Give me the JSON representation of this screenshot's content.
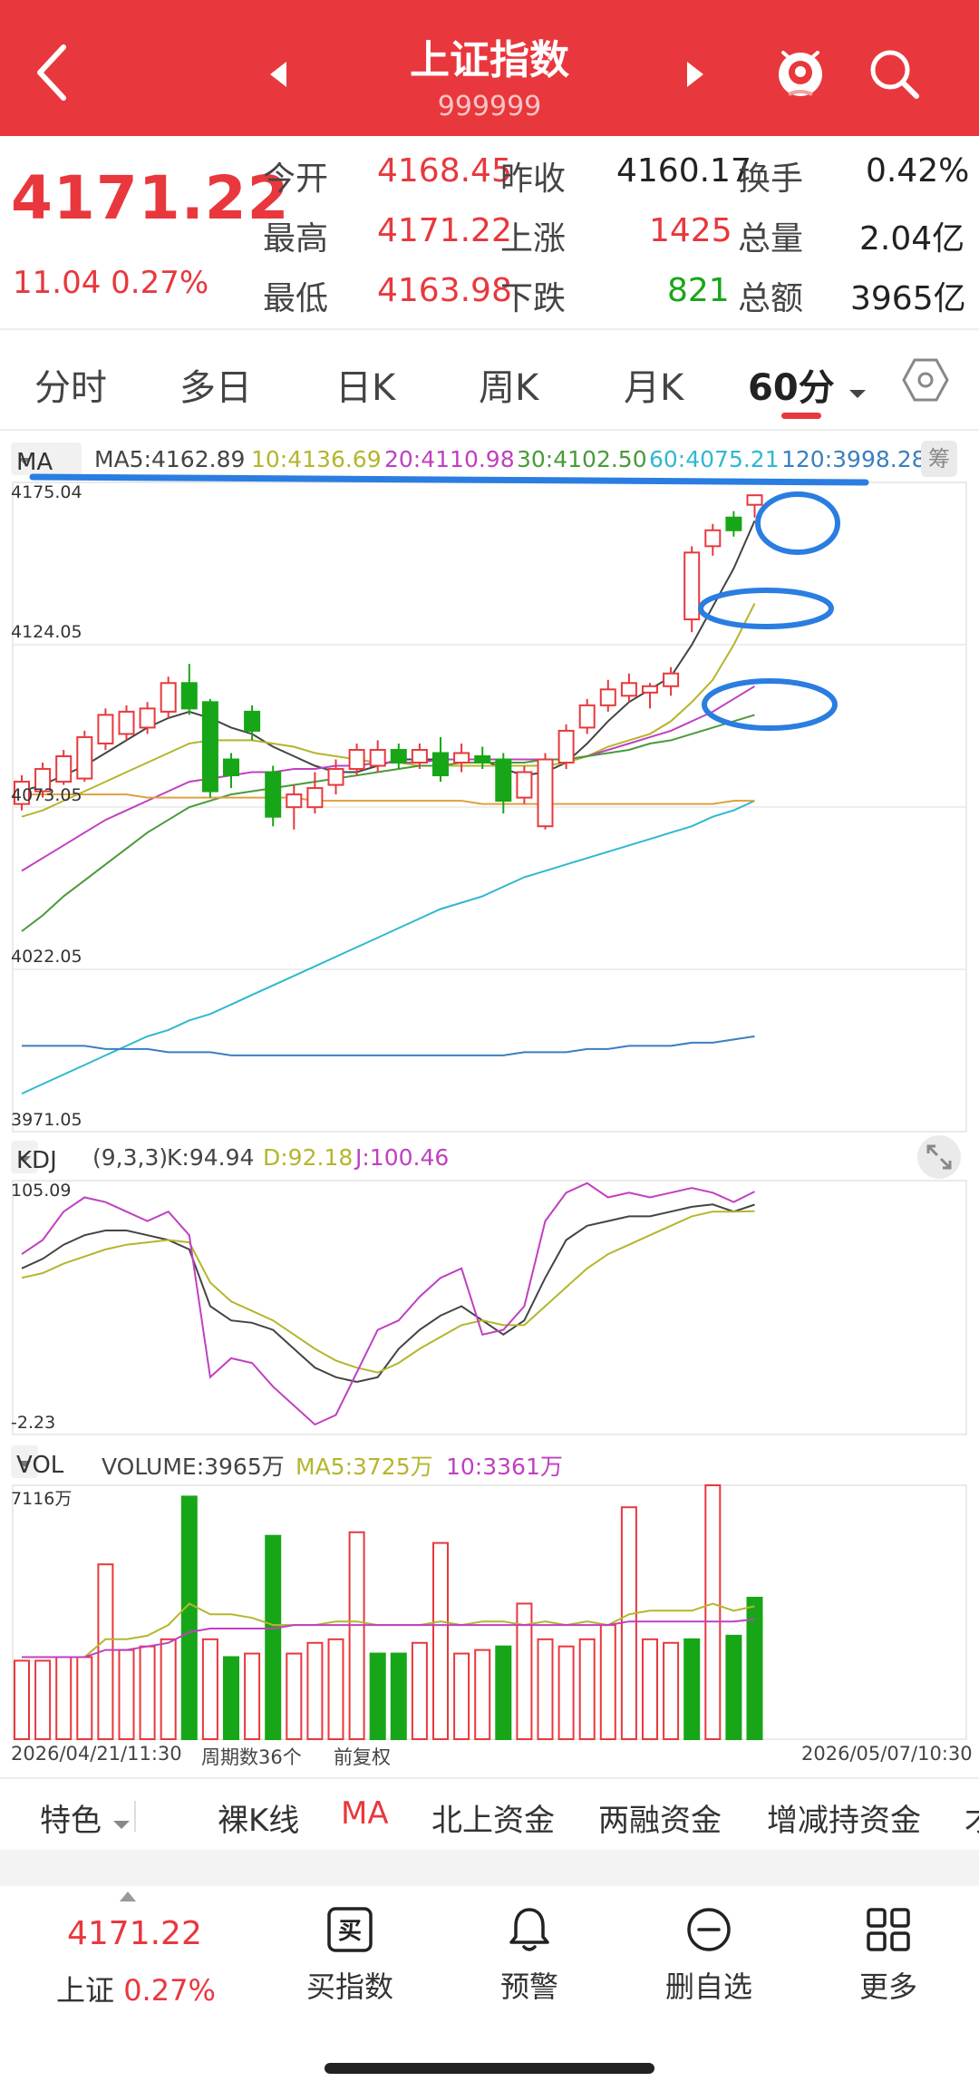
{
  "header": {
    "title": "上证指数",
    "code": "999999",
    "bg_color": "#e8383d"
  },
  "quote": {
    "price": "4171.22",
    "change": "11.04",
    "change_pct": "0.27%",
    "rows": [
      {
        "l1": "今开",
        "v1": "4168.45",
        "l2": "昨收",
        "v2": "4160.17",
        "l3": "换手",
        "v3": "0.42%"
      },
      {
        "l1": "最高",
        "v1": "4171.22",
        "l2": "上涨",
        "v2": "1425",
        "l3": "总量",
        "v3": "2.04亿"
      },
      {
        "l1": "最低",
        "v1": "4163.98",
        "l2": "下跌",
        "v2": "821",
        "l3": "总额",
        "v3": "3965亿"
      }
    ]
  },
  "tabs": {
    "items": [
      "分时",
      "多日",
      "日K",
      "周K",
      "月K",
      "60分"
    ],
    "active": "60分"
  },
  "ma_legend": {
    "selector": "MA",
    "ma5": "MA5:4162.89",
    "ma10": "10:4136.69",
    "ma20": "20:4110.98",
    "ma30": "30:4102.50",
    "ma60": "60:4075.21",
    "ma120": "120:3998.28",
    "chou": "筹"
  },
  "axis": {
    "y1": "4175.04",
    "y2": "4124.05",
    "y3": "4073.05",
    "y4": "4022.05",
    "y5": "3971.05"
  },
  "kdj": {
    "selector": "KDJ",
    "params": "(9,3,3)",
    "k": "K:94.94",
    "d": "D:92.18",
    "j": "J:100.46",
    "top": "105.09",
    "bottom": "-2.23"
  },
  "vol": {
    "selector": "VOL",
    "volume": "VOLUME:3965万",
    "ma5": "MA5:3725万",
    "ma10": "10:3361万",
    "top": "7116万"
  },
  "dates": {
    "start": "2026/04/21/11:30",
    "periods": "周期数36个",
    "adjust": "前复权",
    "end": "2026/05/07/10:30"
  },
  "indicator_tabs": {
    "first": "特色",
    "items": [
      "裸K线",
      "MA",
      "北上资金",
      "两融资金",
      "增减持资金",
      "才"
    ],
    "active": "MA"
  },
  "bottom": {
    "price": "4171.22",
    "name": "上证",
    "pct": "0.27%",
    "buy_icon_char": "买",
    "buy": "买指数",
    "alert": "预警",
    "remove": "删自选",
    "more": "更多"
  },
  "colors": {
    "up": "#e8383d",
    "down": "#17a617",
    "ma5": "#444444",
    "ma10": "#b5b52e",
    "ma20": "#c040c0",
    "ma30": "#4a9a3a",
    "ma60": "#2fb8d0",
    "ma120": "#3a7fc0",
    "annotation": "#2a7de1"
  },
  "chart_data": [
    {
      "type": "candlestick",
      "title": "上证指数 60分",
      "ylim": [
        3971.05,
        4175.04
      ],
      "y_ticks": [
        4175.04,
        4124.05,
        4073.05,
        4022.05,
        3971.05
      ],
      "x_start": "2026/04/21/11:30",
      "x_end": "2026/05/07/10:30",
      "candles": [
        [
          4074,
          4081,
          4072,
          4083
        ],
        [
          4078,
          4085,
          4076,
          4087
        ],
        [
          4081,
          4089,
          4080,
          4091
        ],
        [
          4082,
          4095,
          4081,
          4097
        ],
        [
          4093,
          4102,
          4091,
          4104
        ],
        [
          4096,
          4103,
          4094,
          4105
        ],
        [
          4098,
          4104,
          4096,
          4106
        ],
        [
          4103,
          4112,
          4101,
          4114
        ],
        [
          4112,
          4104,
          4102,
          4118
        ],
        [
          4106,
          4078,
          4076,
          4107
        ],
        [
          4088,
          4083,
          4079,
          4090
        ],
        [
          4103,
          4097,
          4094,
          4105
        ],
        [
          4084,
          4070,
          4067,
          4086
        ],
        [
          4073,
          4077,
          4066,
          4080
        ],
        [
          4073,
          4079,
          4071,
          4084
        ],
        [
          4080,
          4085,
          4077,
          4088
        ],
        [
          4085,
          4091,
          4083,
          4093
        ],
        [
          4086,
          4091,
          4084,
          4094
        ],
        [
          4091,
          4087,
          4085,
          4093
        ],
        [
          4087,
          4091,
          4085,
          4093
        ],
        [
          4090,
          4083,
          4081,
          4095
        ],
        [
          4087,
          4090,
          4084,
          4093
        ],
        [
          4089,
          4087,
          4085,
          4092
        ],
        [
          4088,
          4075,
          4071,
          4090
        ],
        [
          4076,
          4084,
          4074,
          4086
        ],
        [
          4067,
          4088,
          4066,
          4090
        ],
        [
          4087,
          4097,
          4085,
          4099
        ],
        [
          4098,
          4105,
          4096,
          4107
        ],
        [
          4105,
          4110,
          4103,
          4113
        ],
        [
          4108,
          4112,
          4106,
          4115
        ],
        [
          4109,
          4111,
          4104,
          4112
        ],
        [
          4111,
          4115,
          4108,
          4117
        ],
        [
          4132,
          4153,
          4128,
          4155
        ],
        [
          4155,
          4160,
          4152,
          4162
        ],
        [
          4164,
          4160,
          4158,
          4166
        ],
        [
          4168,
          4171,
          4164,
          4171
        ]
      ],
      "ma_series": {
        "MA5": [
          4078,
          4080,
          4083,
          4086,
          4090,
          4094,
          4098,
          4101,
          4103,
          4101,
          4098,
          4096,
          4092,
          4089,
          4086,
          4084,
          4084,
          4086,
          4088,
          4088,
          4088,
          4088,
          4088,
          4085,
          4083,
          4084,
          4087,
          4093,
          4100,
          4106,
          4110,
          4114,
          4124,
          4136,
          4148,
          4163
        ],
        "MA10": [
          4070,
          4072,
          4075,
          4078,
          4081,
          4084,
          4087,
          4090,
          4093,
          4094,
          4094,
          4094,
          4093,
          4092,
          4090,
          4089,
          4088,
          4087,
          4087,
          4086,
          4086,
          4086,
          4086,
          4086,
          4086,
          4086,
          4087,
          4089,
          4092,
          4094,
          4096,
          4100,
          4106,
          4113,
          4124,
          4137
        ],
        "MA20": [
          4053,
          4057,
          4061,
          4065,
          4069,
          4072,
          4075,
          4078,
          4081,
          4082,
          4083,
          4084,
          4084,
          4085,
          4085,
          4086,
          4086,
          4087,
          4087,
          4087,
          4088,
          4088,
          4088,
          4088,
          4088,
          4088,
          4088,
          4089,
          4091,
          4093,
          4095,
          4097,
          4100,
          4103,
          4107,
          4111
        ],
        "MA30": [
          4034,
          4039,
          4045,
          4050,
          4055,
          4060,
          4065,
          4069,
          4073,
          4075,
          4077,
          4078,
          4079,
          4080,
          4081,
          4082,
          4083,
          4084,
          4085,
          4086,
          4086,
          4087,
          4087,
          4087,
          4087,
          4088,
          4088,
          4089,
          4090,
          4091,
          4093,
          4094,
          4096,
          4098,
          4100,
          4102
        ],
        "MA60": [
          3983,
          3986,
          3989,
          3992,
          3995,
          3998,
          4001,
          4003,
          4006,
          4008,
          4011,
          4014,
          4017,
          4020,
          4023,
          4026,
          4029,
          4032,
          4035,
          4038,
          4041,
          4043,
          4045,
          4048,
          4051,
          4053,
          4055,
          4057,
          4059,
          4061,
          4063,
          4065,
          4067,
          4070,
          4072,
          4075
        ],
        "MA120": [
          3998,
          3998,
          3998,
          3998,
          3997,
          3997,
          3997,
          3996,
          3996,
          3996,
          3995,
          3995,
          3995,
          3995,
          3995,
          3995,
          3995,
          3995,
          3995,
          3995,
          3995,
          3995,
          3995,
          3995,
          3996,
          3996,
          3996,
          3997,
          3997,
          3998,
          3998,
          3998,
          3999,
          3999,
          4000,
          4001
        ],
        "MA_orange": [
          4077,
          4077,
          4077,
          4077,
          4077,
          4077,
          4076,
          4076,
          4076,
          4076,
          4076,
          4076,
          4076,
          4076,
          4075,
          4075,
          4075,
          4075,
          4075,
          4075,
          4075,
          4075,
          4074,
          4074,
          4074,
          4074,
          4074,
          4074,
          4074,
          4074,
          4074,
          4074,
          4074,
          4074,
          4075,
          4075
        ]
      }
    },
    {
      "type": "line",
      "title": "KDJ (9,3,3)",
      "ylim": [
        -2.23,
        105.09
      ],
      "series": [
        {
          "name": "K",
          "values": [
            68,
            72,
            78,
            82,
            84,
            84,
            82,
            80,
            76,
            52,
            46,
            45,
            42,
            34,
            26,
            22,
            20,
            22,
            34,
            42,
            48,
            52,
            46,
            40,
            46,
            64,
            80,
            86,
            88,
            90,
            90,
            92,
            94,
            95,
            92,
            94.94
          ]
        },
        {
          "name": "D",
          "values": [
            64,
            66,
            70,
            73,
            76,
            78,
            79,
            80,
            79,
            62,
            54,
            50,
            46,
            40,
            34,
            29,
            26,
            24,
            28,
            34,
            39,
            44,
            46,
            44,
            44,
            52,
            60,
            68,
            74,
            78,
            82,
            86,
            90,
            92,
            92,
            92.18
          ]
        },
        {
          "name": "J",
          "values": [
            74,
            80,
            92,
            98,
            96,
            92,
            88,
            92,
            82,
            22,
            30,
            28,
            18,
            10,
            2,
            6,
            24,
            42,
            46,
            56,
            64,
            68,
            40,
            42,
            52,
            88,
            100,
            104,
            98,
            100,
            98,
            100,
            102,
            100,
            96,
            100.46
          ]
        }
      ]
    },
    {
      "type": "bar",
      "title": "VOLUME",
      "ylim": [
        0,
        7116
      ],
      "unit": "万",
      "values": [
        2200,
        2200,
        2300,
        2300,
        4900,
        2500,
        2600,
        2800,
        6800,
        2800,
        2300,
        2400,
        5700,
        2400,
        2700,
        2800,
        5800,
        2400,
        2400,
        2700,
        5500,
        2400,
        2500,
        2600,
        3800,
        2800,
        2600,
        2800,
        3200,
        6500,
        2800,
        2700,
        2800,
        7116,
        2900,
        3965
      ],
      "direction": [
        "up",
        "up",
        "up",
        "up",
        "up",
        "up",
        "up",
        "up",
        "down",
        "up",
        "down",
        "up",
        "down",
        "up",
        "up",
        "up",
        "up",
        "down",
        "down",
        "up",
        "up",
        "up",
        "up",
        "down",
        "up",
        "up",
        "up",
        "up",
        "up",
        "up",
        "up",
        "up",
        "down",
        "up",
        "down",
        "down"
      ],
      "series": [
        {
          "name": "MA5",
          "values": [
            2300,
            2300,
            2300,
            2300,
            2800,
            2800,
            2900,
            3200,
            3800,
            3500,
            3500,
            3400,
            3200,
            3200,
            3200,
            3300,
            3300,
            3200,
            3200,
            3200,
            3300,
            3200,
            3300,
            3300,
            3200,
            3300,
            3200,
            3300,
            3200,
            3500,
            3600,
            3600,
            3600,
            3800,
            3600,
            3725
          ]
        },
        {
          "name": "10",
          "values": [
            2300,
            2300,
            2300,
            2300,
            2500,
            2500,
            2600,
            2700,
            3000,
            3100,
            3100,
            3100,
            3100,
            3200,
            3200,
            3200,
            3200,
            3200,
            3200,
            3200,
            3200,
            3200,
            3200,
            3200,
            3200,
            3200,
            3200,
            3200,
            3200,
            3300,
            3300,
            3300,
            3300,
            3300,
            3300,
            3361
          ]
        }
      ]
    }
  ]
}
